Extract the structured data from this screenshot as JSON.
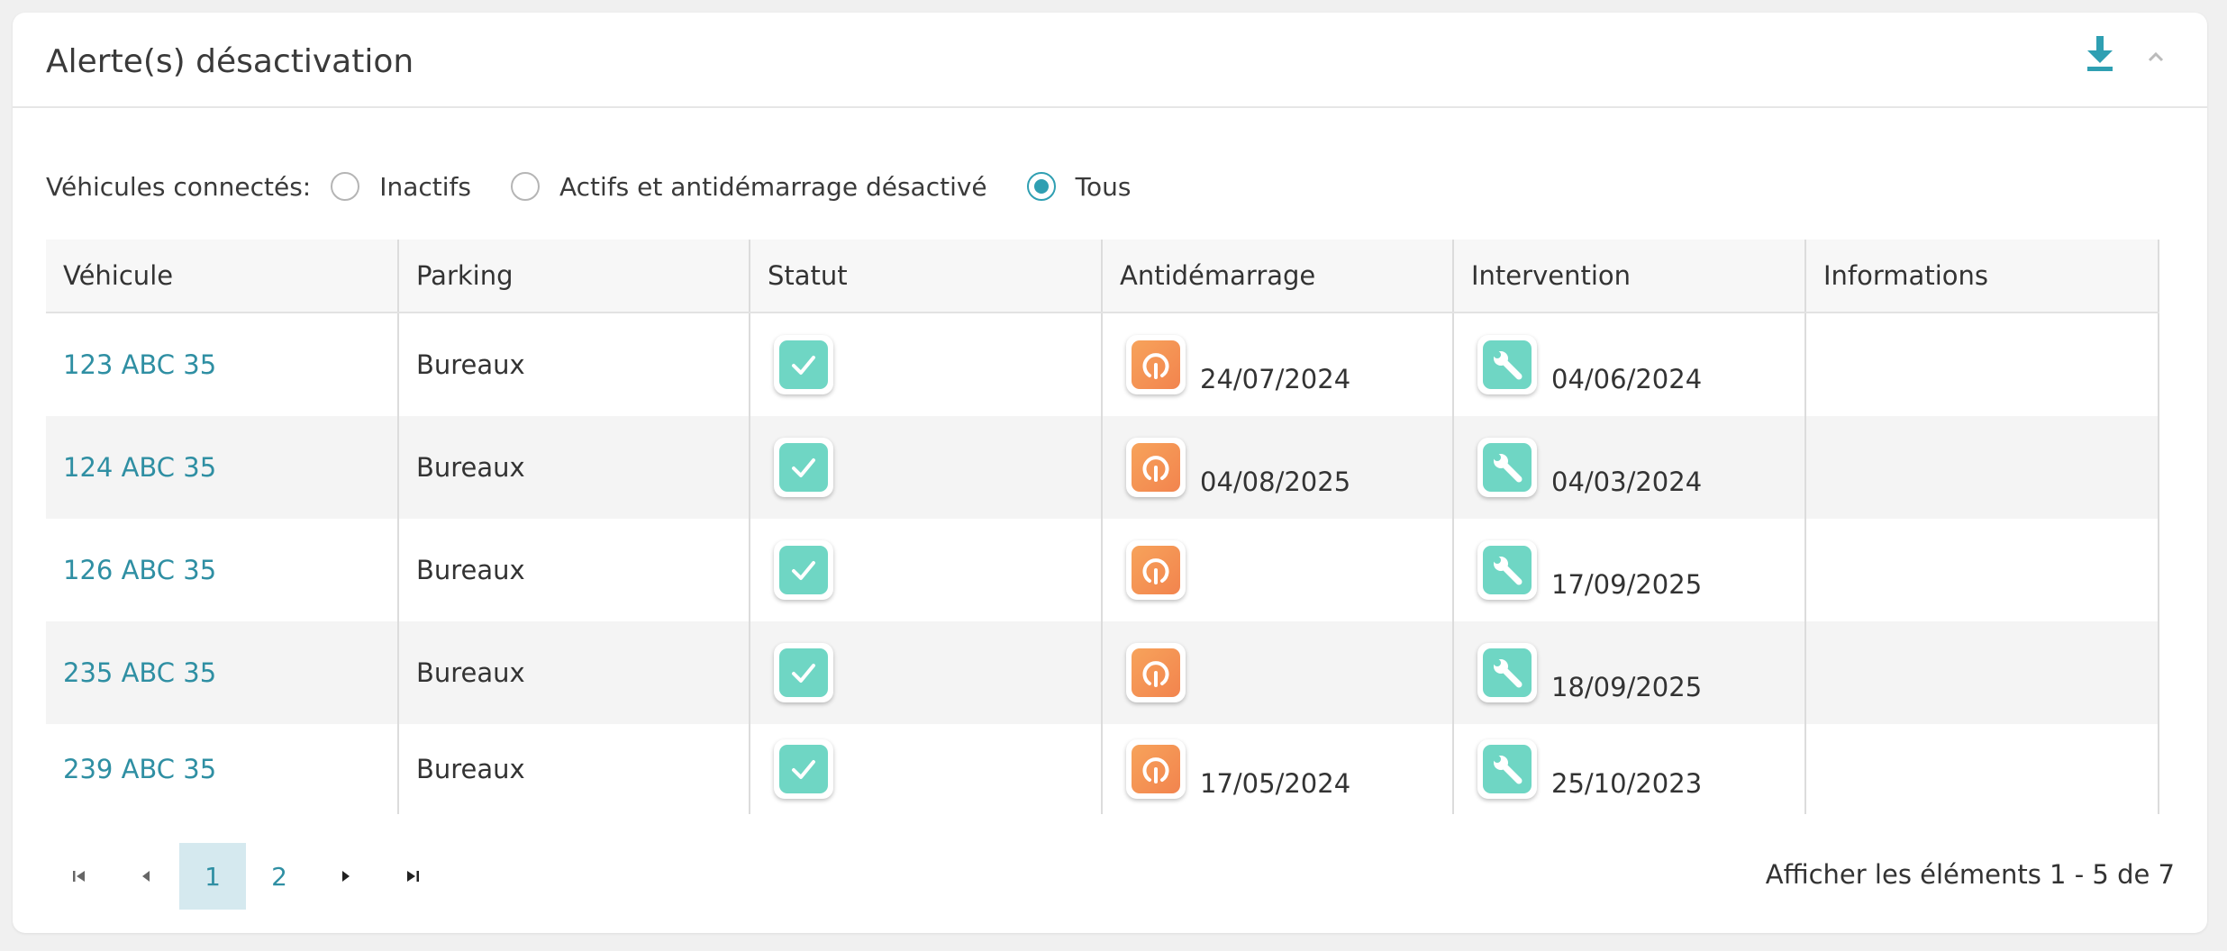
{
  "header": {
    "title": "Alerte(s) désactivation"
  },
  "filter": {
    "label": "Véhicules connectés:",
    "options": [
      {
        "label": "Inactifs",
        "checked": false
      },
      {
        "label": "Actifs et antidémarrage désactivé",
        "checked": false
      },
      {
        "label": "Tous",
        "checked": true
      }
    ]
  },
  "table": {
    "columns": [
      "Véhicule",
      "Parking",
      "Statut",
      "Antidémarrage",
      "Intervention",
      "Informations"
    ],
    "rows": [
      {
        "vehicle": "123 ABC 35",
        "parking": "Bureaux",
        "antistart_date": "24/07/2024",
        "intervention_date": "04/06/2024",
        "info": ""
      },
      {
        "vehicle": "124 ABC 35",
        "parking": "Bureaux",
        "antistart_date": "04/08/2025",
        "intervention_date": "04/03/2024",
        "info": ""
      },
      {
        "vehicle": "126 ABC 35",
        "parking": "Bureaux",
        "antistart_date": "",
        "intervention_date": "17/09/2025",
        "info": ""
      },
      {
        "vehicle": "235 ABC 35",
        "parking": "Bureaux",
        "antistart_date": "",
        "intervention_date": "18/09/2025",
        "info": ""
      },
      {
        "vehicle": "239 ABC 35",
        "parking": "Bureaux",
        "antistart_date": "17/05/2024",
        "intervention_date": "25/10/2023",
        "info": ""
      }
    ]
  },
  "pagination": {
    "pages": [
      "1",
      "2"
    ],
    "current": "1",
    "info": "Afficher les éléments 1 - 5 de 7"
  },
  "icons": {
    "download": "download-icon",
    "collapse": "chevron-up-icon",
    "status": "check-icon",
    "antistart": "power-icon",
    "intervention": "wrench-icon",
    "first": "first-page-icon",
    "prev": "prev-page-icon",
    "next": "next-page-icon",
    "last": "last-page-icon"
  },
  "colors": {
    "accent": "#2f9fb2",
    "link": "#2f8fa3",
    "teal": "#6fd6c4",
    "orange": "#f2844e"
  }
}
